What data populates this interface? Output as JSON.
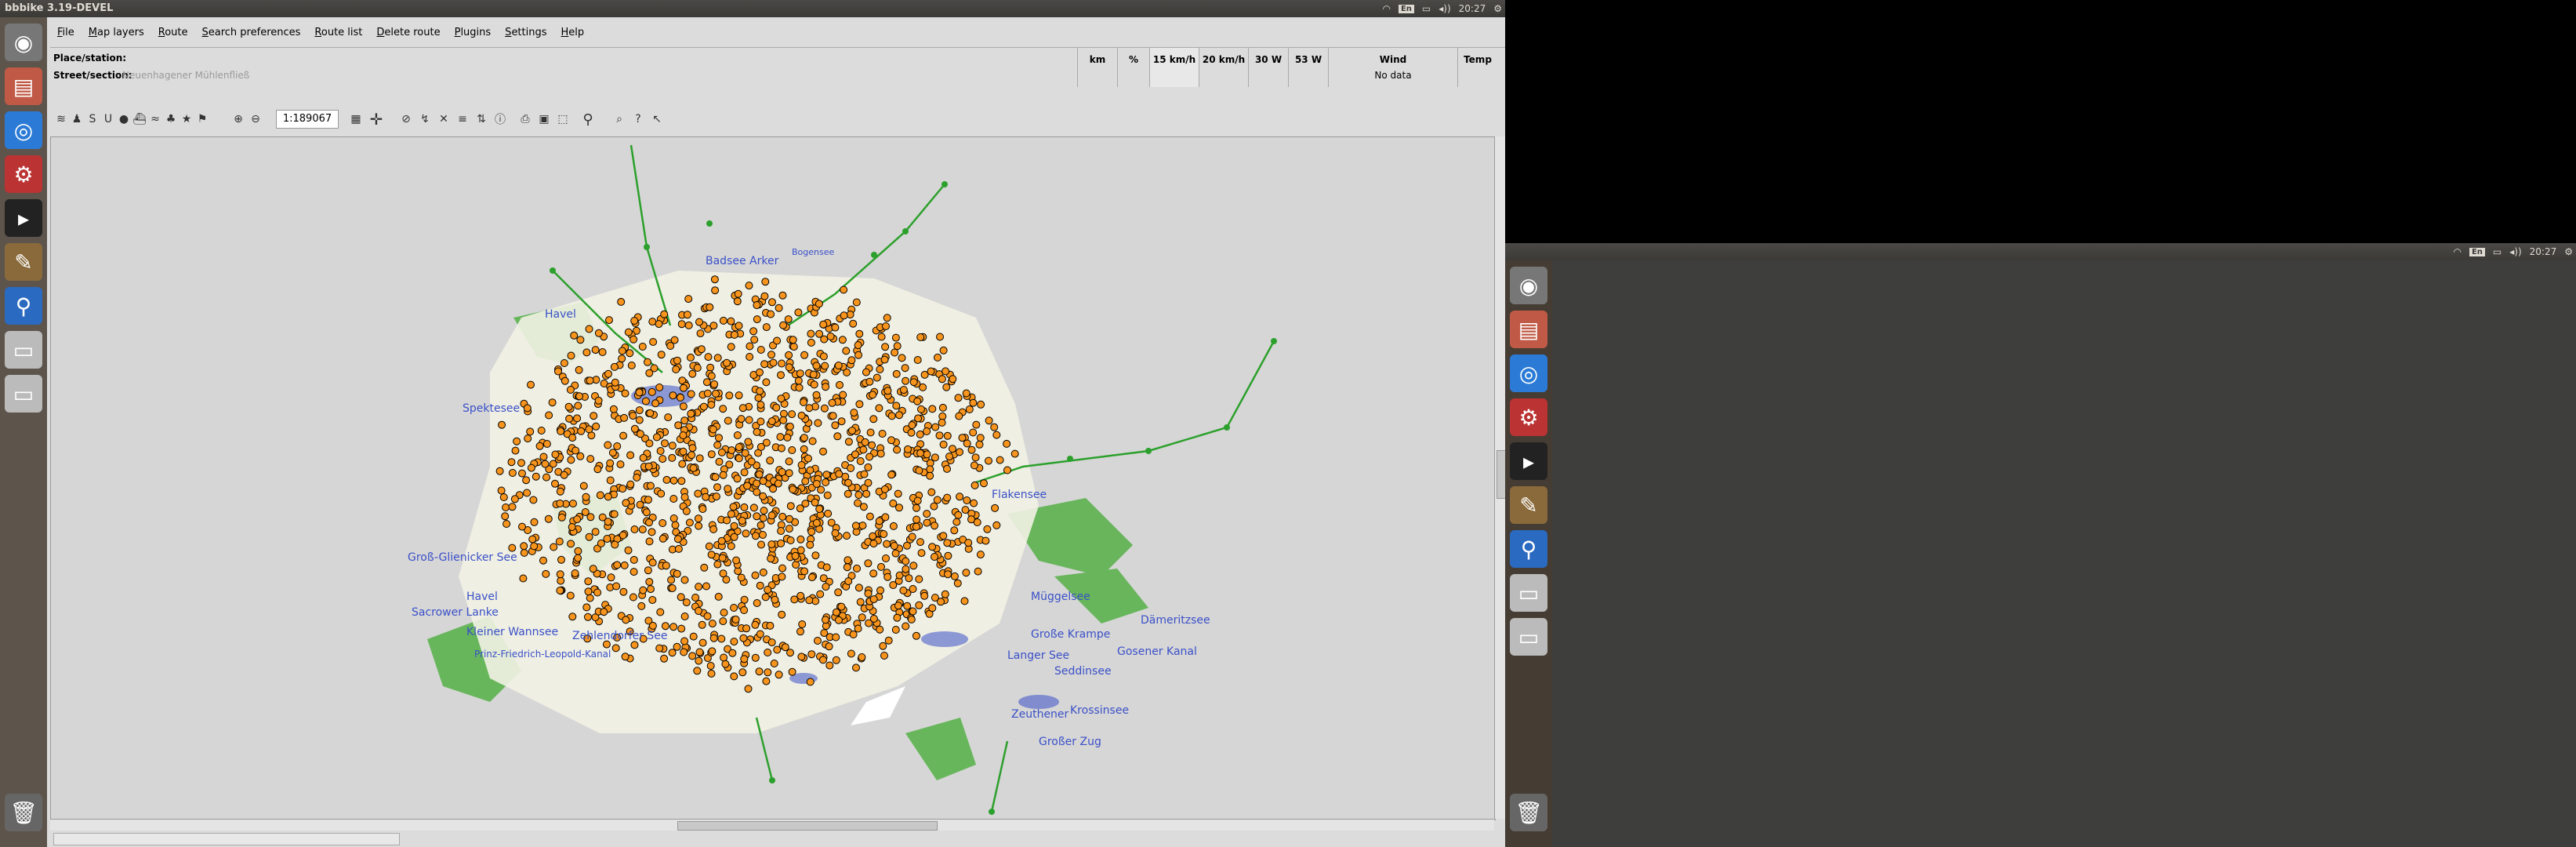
{
  "left_panel": {
    "title": "bbbike 3.19-DEVEL",
    "lang": "En",
    "clock": "20:27"
  },
  "right_panel": {
    "lang": "En",
    "clock": "20:27"
  },
  "menu": [
    "File",
    "Map layers",
    "Route",
    "Search preferences",
    "Route list",
    "Delete route",
    "Plugins",
    "Settings",
    "Help"
  ],
  "info": {
    "place_label": "Place/station:",
    "street_label": "Street/section:",
    "street_value": "Neuenhagener Mühlenfließ",
    "columns": [
      "km",
      "%",
      "15 km/h",
      "20 km/h",
      "30 W",
      "53 W"
    ],
    "wind_label": "Wind",
    "wind_value": "No data",
    "temp_label": "Temp"
  },
  "toolbar": {
    "scale": "1:189067"
  },
  "map_labels": [
    {
      "text": "Badsee Arker"
    },
    {
      "text": "Bogensee"
    },
    {
      "text": "Havel"
    },
    {
      "text": "Spektesee"
    },
    {
      "text": "Groß-Glienicker See"
    },
    {
      "text": "Sacrower Lanke"
    },
    {
      "text": "Havel"
    },
    {
      "text": "Kleiner Wannsee"
    },
    {
      "text": "Zehlendorfer See"
    },
    {
      "text": "Prinz-Friedrich-Leopold-Kanal"
    },
    {
      "text": "Langer See"
    },
    {
      "text": "Große Krampe"
    },
    {
      "text": "Seddinsee"
    },
    {
      "text": "Krossinsee"
    },
    {
      "text": "Zeuthener"
    },
    {
      "text": "Großer Zug"
    },
    {
      "text": "Müggelsee"
    },
    {
      "text": "Dämeritzsee"
    },
    {
      "text": "Gosener Kanal"
    },
    {
      "text": "Flakensee"
    }
  ],
  "colors": {
    "route_orange": "#f7941d",
    "rail_green": "#2ca02c",
    "water_blue": "#3a50c8",
    "forest_green": "#4aa84a"
  }
}
